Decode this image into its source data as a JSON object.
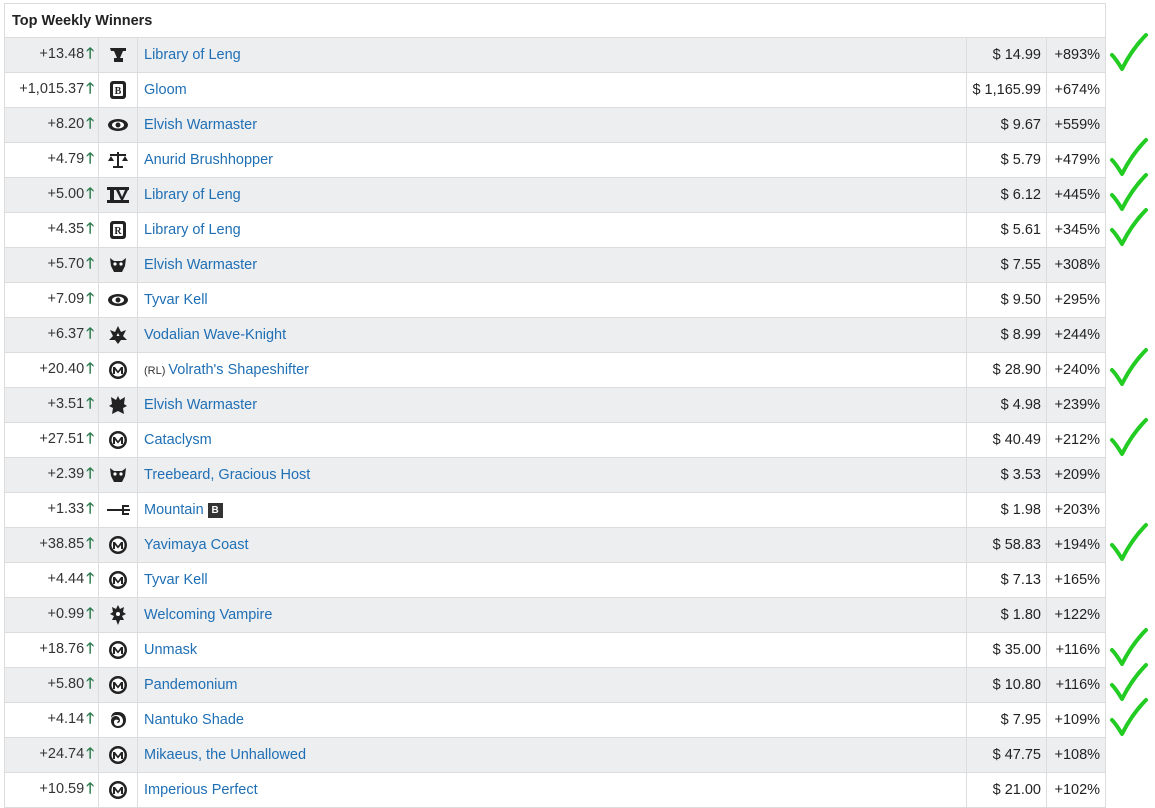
{
  "table": {
    "title": "Top Weekly Winners",
    "up_arrow": "🡑",
    "rows": [
      {
        "change": "+13.48",
        "icon": "set-symbol-v-icon",
        "name": "Library of Leng",
        "prefix": "",
        "badge": "",
        "price": "$ 14.99",
        "pct": "+893%",
        "checked": true
      },
      {
        "change": "+1,015.37",
        "icon": "set-symbol-card-b-icon",
        "name": "Gloom",
        "prefix": "",
        "badge": "",
        "price": "$ 1,165.99",
        "pct": "+674%",
        "checked": false
      },
      {
        "change": "+8.20",
        "icon": "set-symbol-eye-icon",
        "name": "Elvish Warmaster",
        "prefix": "",
        "badge": "",
        "price": "$ 9.67",
        "pct": "+559%",
        "checked": false
      },
      {
        "change": "+4.79",
        "icon": "set-symbol-scales-icon",
        "name": "Anurid Brushhopper",
        "prefix": "",
        "badge": "",
        "price": "$ 5.79",
        "pct": "+479%",
        "checked": true
      },
      {
        "change": "+5.00",
        "icon": "set-symbol-iv-icon",
        "name": "Library of Leng",
        "prefix": "",
        "badge": "",
        "price": "$ 6.12",
        "pct": "+445%",
        "checked": true
      },
      {
        "change": "+4.35",
        "icon": "set-symbol-card-r-icon",
        "name": "Library of Leng",
        "prefix": "",
        "badge": "",
        "price": "$ 5.61",
        "pct": "+345%",
        "checked": true
      },
      {
        "change": "+5.70",
        "icon": "set-symbol-beast-icon",
        "name": "Elvish Warmaster",
        "prefix": "",
        "badge": "",
        "price": "$ 7.55",
        "pct": "+308%",
        "checked": false
      },
      {
        "change": "+7.09",
        "icon": "set-symbol-eye-icon",
        "name": "Tyvar Kell",
        "prefix": "",
        "badge": "",
        "price": "$ 9.50",
        "pct": "+295%",
        "checked": false
      },
      {
        "change": "+6.37",
        "icon": "set-symbol-spire-icon",
        "name": "Vodalian Wave-Knight",
        "prefix": "",
        "badge": "",
        "price": "$ 8.99",
        "pct": "+244%",
        "checked": false
      },
      {
        "change": "+20.40",
        "icon": "set-symbol-m-icon",
        "name": "Volrath's Shapeshifter",
        "prefix": "(RL)",
        "badge": "",
        "price": "$ 28.90",
        "pct": "+240%",
        "checked": true
      },
      {
        "change": "+3.51",
        "icon": "set-symbol-helm-icon",
        "name": "Elvish Warmaster",
        "prefix": "",
        "badge": "",
        "price": "$ 4.98",
        "pct": "+239%",
        "checked": false
      },
      {
        "change": "+27.51",
        "icon": "set-symbol-m-icon",
        "name": "Cataclysm",
        "prefix": "",
        "badge": "",
        "price": "$ 40.49",
        "pct": "+212%",
        "checked": true
      },
      {
        "change": "+2.39",
        "icon": "set-symbol-beast-icon",
        "name": "Treebeard, Gracious Host",
        "prefix": "",
        "badge": "",
        "price": "$ 3.53",
        "pct": "+209%",
        "checked": false
      },
      {
        "change": "+1.33",
        "icon": "set-symbol-trident-icon",
        "name": "Mountain",
        "prefix": "",
        "badge": "B",
        "price": "$ 1.98",
        "pct": "+203%",
        "checked": false
      },
      {
        "change": "+38.85",
        "icon": "set-symbol-m-icon",
        "name": "Yavimaya Coast",
        "prefix": "",
        "badge": "",
        "price": "$ 58.83",
        "pct": "+194%",
        "checked": true
      },
      {
        "change": "+4.44",
        "icon": "set-symbol-m-icon",
        "name": "Tyvar Kell",
        "prefix": "",
        "badge": "",
        "price": "$ 7.13",
        "pct": "+165%",
        "checked": false
      },
      {
        "change": "+0.99",
        "icon": "set-symbol-crown-icon",
        "name": "Welcoming Vampire",
        "prefix": "",
        "badge": "",
        "price": "$ 1.80",
        "pct": "+122%",
        "checked": false
      },
      {
        "change": "+18.76",
        "icon": "set-symbol-m-icon",
        "name": "Unmask",
        "prefix": "",
        "badge": "",
        "price": "$ 35.00",
        "pct": "+116%",
        "checked": true
      },
      {
        "change": "+5.80",
        "icon": "set-symbol-m-icon",
        "name": "Pandemonium",
        "prefix": "",
        "badge": "",
        "price": "$ 10.80",
        "pct": "+116%",
        "checked": true
      },
      {
        "change": "+4.14",
        "icon": "set-symbol-swirl-icon",
        "name": "Nantuko Shade",
        "prefix": "",
        "badge": "",
        "price": "$ 7.95",
        "pct": "+109%",
        "checked": true
      },
      {
        "change": "+24.74",
        "icon": "set-symbol-m-icon",
        "name": "Mikaeus, the Unhallowed",
        "prefix": "",
        "badge": "",
        "price": "$ 47.75",
        "pct": "+108%",
        "checked": false
      },
      {
        "change": "+10.59",
        "icon": "set-symbol-m-icon",
        "name": "Imperious Perfect",
        "prefix": "",
        "badge": "",
        "price": "$ 21.00",
        "pct": "+102%",
        "checked": false
      }
    ]
  },
  "colors": {
    "link": "#1f6fb5",
    "up_arrow": "#2e7d4f",
    "checkmark": "#22cc22",
    "stripe": "#eceef0"
  }
}
